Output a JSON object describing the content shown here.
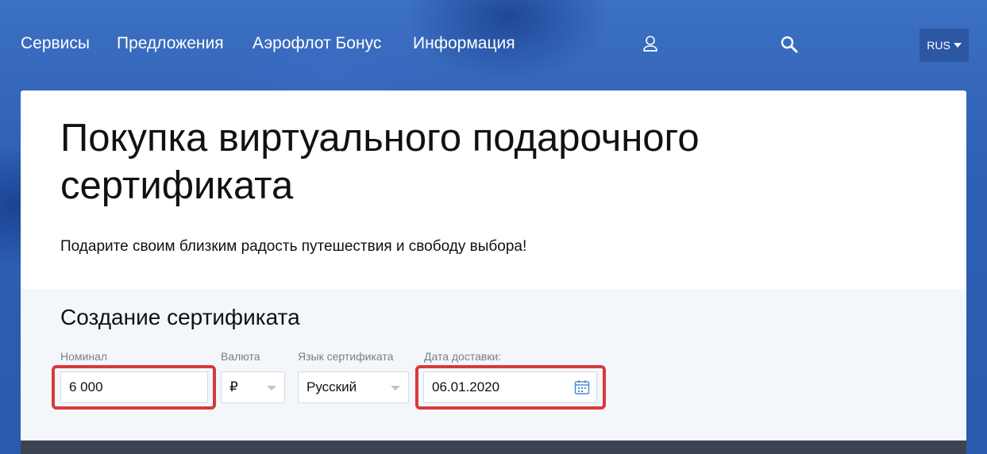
{
  "nav": {
    "items": [
      "Сервисы",
      "Предложения",
      "Аэрофлот Бонус",
      "Информация"
    ],
    "profile_icon": "user-icon",
    "search_icon": "search-icon",
    "language": "RUS"
  },
  "page": {
    "title": "Покупка виртуального подарочного сертификата",
    "subtitle": "Подарите своим близким радость путешествия и свободу выбора!"
  },
  "form": {
    "section_title": "Создание сертификата",
    "nominal_label": "Номинал",
    "nominal_value": "6 000",
    "currency_label": "Валюта",
    "currency_value": "₽",
    "language_label": "Язык сертификата",
    "language_value": "Русский",
    "date_label": "Дата доставки:",
    "date_value": "06.01.2020",
    "calendar_icon": "calendar-icon"
  },
  "colors": {
    "header_blue": "#2f63b4",
    "highlight_red": "#d83a3a",
    "form_bg": "#f3f7fc",
    "calendar_blue": "#4a8fd6"
  }
}
